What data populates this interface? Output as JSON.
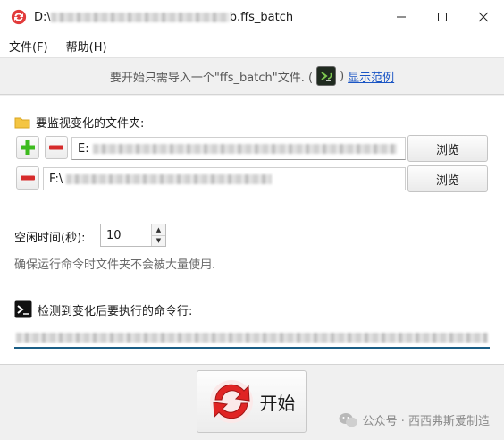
{
  "window": {
    "title_prefix": "D:\\",
    "title_suffix": "b.ffs_batch",
    "controls": {
      "minimize": "minimize",
      "maximize": "maximize",
      "close": "close"
    }
  },
  "menu": {
    "file": "文件(F)",
    "help": "帮助(H)"
  },
  "hint": {
    "text": "要开始只需导入一个\"ffs_batch\"文件. (",
    "close_paren": ")",
    "link": "显示范例"
  },
  "watch": {
    "title": "要监视变化的文件夹:",
    "folders": [
      {
        "prefix": "E:"
      },
      {
        "prefix": "F:\\"
      }
    ],
    "browse": "浏览"
  },
  "idle": {
    "label": "空闲时间(秒):",
    "value": "10",
    "note": "确保运行命令时文件夹不会被大量使用."
  },
  "command": {
    "title": "检测到变化后要执行的命令行:"
  },
  "start": {
    "label": "开始"
  },
  "watermark": {
    "text": "公众号 · 西西弗斯爱制造"
  },
  "colors": {
    "accent_blue": "#1a55c4",
    "cmd_underline": "#1b5e86",
    "plus_green": "#3dbb1e",
    "minus_red": "#d62b2b",
    "folder_yellow": "#f4c542"
  }
}
